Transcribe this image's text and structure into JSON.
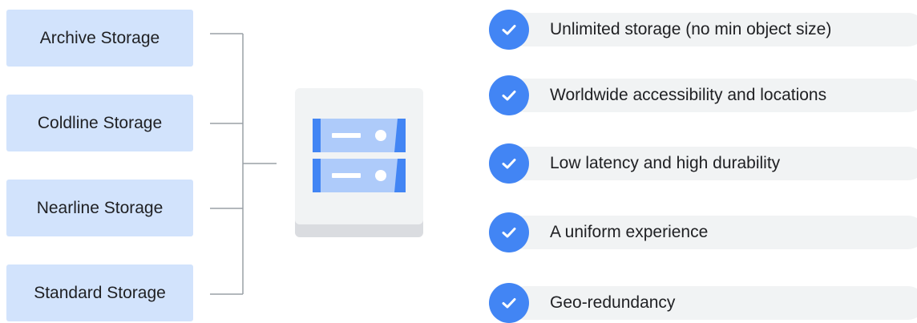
{
  "storage_classes": [
    {
      "label": "Archive Storage"
    },
    {
      "label": "Coldline Storage"
    },
    {
      "label": "Nearline Storage"
    },
    {
      "label": "Standard Storage"
    }
  ],
  "features": [
    {
      "label": "Unlimited storage (no min object size)"
    },
    {
      "label": "Worldwide accessibility and locations"
    },
    {
      "label": "Low latency and high durability"
    },
    {
      "label": "A uniform experience"
    },
    {
      "label": "Geo-redundancy"
    }
  ],
  "colors": {
    "class_box": "#d2e3fc",
    "accent_blue": "#4285f4",
    "light_blue": "#aecbfa",
    "pill": "#f1f3f4",
    "connector": "#9aa0a6"
  },
  "icons": {
    "server": "storage-server-icon",
    "check": "check-circle-icon"
  }
}
